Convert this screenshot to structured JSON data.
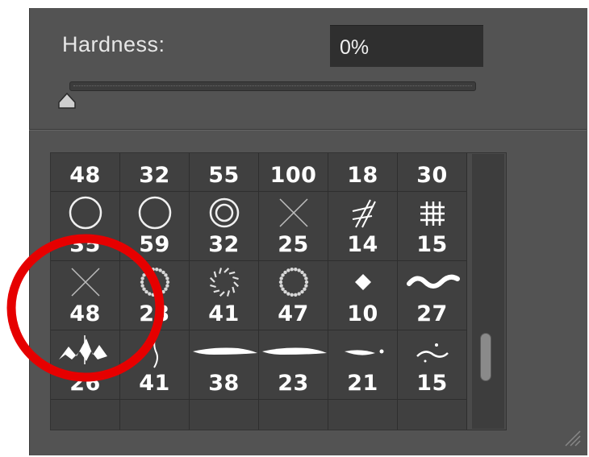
{
  "hardness": {
    "label": "Hardness:",
    "value": "0%",
    "slider_level_percent": 0
  },
  "brush_grid": {
    "rows": [
      [
        {
          "size": "48",
          "brush": "splatter-brush"
        },
        {
          "size": "32",
          "brush": "splatter-brush"
        },
        {
          "size": "55",
          "brush": "soft-round-brush"
        },
        {
          "size": "100",
          "brush": "speckle-brush"
        },
        {
          "size": "18",
          "brush": "ring-brush"
        },
        {
          "size": "30",
          "brush": "ring-brush"
        }
      ],
      [
        {
          "size": "35",
          "brush": "circle-outline-brush"
        },
        {
          "size": "59",
          "brush": "circle-outline-brush"
        },
        {
          "size": "32",
          "brush": "double-circle-brush"
        },
        {
          "size": "25",
          "brush": "cross-brush"
        },
        {
          "size": "14",
          "brush": "hatch-brush"
        },
        {
          "size": "15",
          "brush": "grid-brush"
        }
      ],
      [
        {
          "size": "48",
          "brush": "cross-brush"
        },
        {
          "size": "23",
          "brush": "dotted-ring-brush"
        },
        {
          "size": "41",
          "brush": "dashed-ring-brush"
        },
        {
          "size": "47",
          "brush": "dotted-ring-brush"
        },
        {
          "size": "10",
          "brush": "diamond-brush"
        },
        {
          "size": "27",
          "brush": "wave-brush"
        }
      ],
      [
        {
          "size": "26",
          "brush": "zigzag-brush"
        },
        {
          "size": "41",
          "brush": "thin-stroke-brush"
        },
        {
          "size": "38",
          "brush": "taper-stroke-brush"
        },
        {
          "size": "23",
          "brush": "taper-stroke-brush"
        },
        {
          "size": "21",
          "brush": "comet-brush"
        },
        {
          "size": "15",
          "brush": "swirl-brush"
        }
      ]
    ]
  },
  "colors": {
    "panel": "#535353",
    "field": "#2f2f2f",
    "highlight_circle": "#e60000"
  }
}
